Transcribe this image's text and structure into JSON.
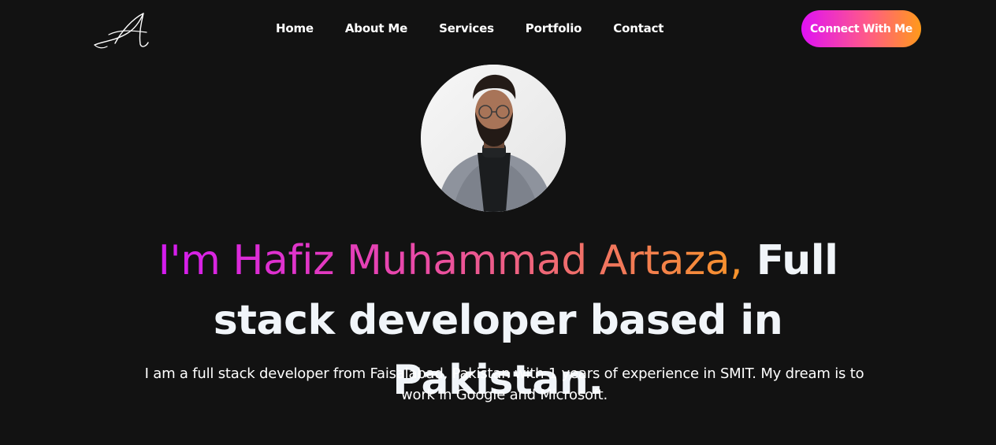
{
  "nav": {
    "logo_icon": "signature-logo-icon",
    "links": [
      {
        "label": "Home"
      },
      {
        "label": "About Me"
      },
      {
        "label": "Services"
      },
      {
        "label": "Portfolio"
      },
      {
        "label": "Contact"
      }
    ],
    "cta_label": "Connect With Me"
  },
  "hero": {
    "avatar_icon": "profile-photo",
    "headline_gradient": "I'm Hafiz Muhammad Artaza,",
    "headline_rest": " Full stack developer based in Pakistan.",
    "description": "I am a full stack developer from Faisalabad, Pakistan with 1 years of experience in SMIT. My dream is to work in Google and Microsoft."
  },
  "colors": {
    "background": "#121212",
    "gradient_start": "#df11f5",
    "gradient_end": "#ff9a1a",
    "text": "#f1f5f9"
  }
}
